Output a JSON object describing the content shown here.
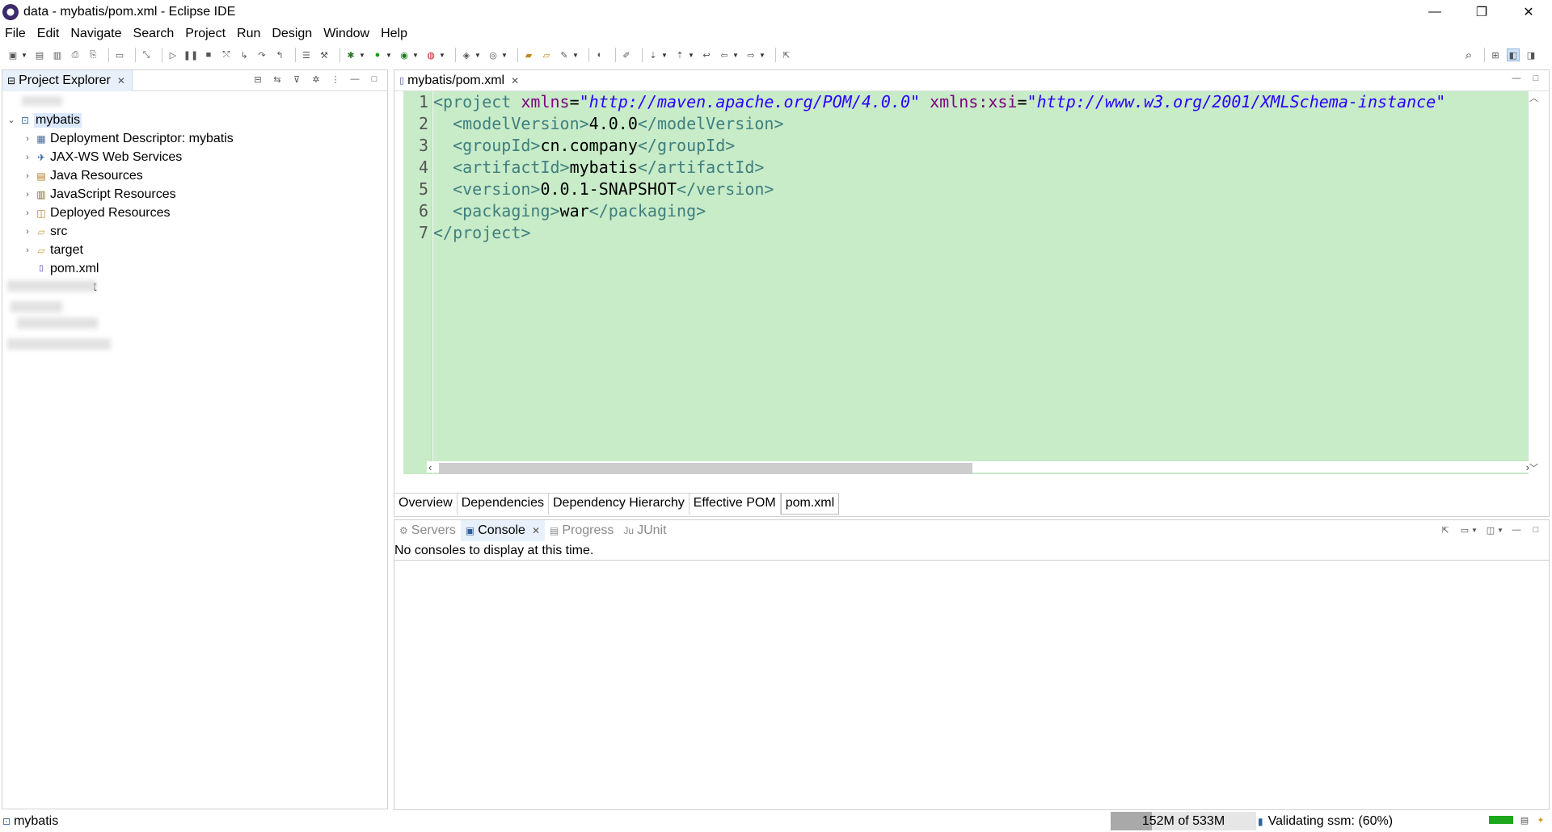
{
  "window": {
    "title": "data - mybatis/pom.xml - Eclipse IDE",
    "controls": {
      "minimize": "—",
      "restore": "❐",
      "close": "✕"
    }
  },
  "menu": [
    "File",
    "Edit",
    "Navigate",
    "Search",
    "Project",
    "Run",
    "Design",
    "Window",
    "Help"
  ],
  "project_explorer": {
    "tab_label": "Project Explorer",
    "tree": [
      {
        "label": "mybatis",
        "icon": "web-project-icon",
        "expanded": true,
        "selected": true
      },
      {
        "label": "Deployment Descriptor: mybatis",
        "icon": "deployment-descriptor-icon"
      },
      {
        "label": "JAX-WS Web Services",
        "icon": "web-services-icon"
      },
      {
        "label": "Java Resources",
        "icon": "java-resources-icon"
      },
      {
        "label": "JavaScript Resources",
        "icon": "javascript-resources-icon"
      },
      {
        "label": "Deployed Resources",
        "icon": "deployed-resources-icon"
      },
      {
        "label": "src",
        "icon": "folder-icon"
      },
      {
        "label": "target",
        "icon": "folder-icon"
      },
      {
        "label": "pom.xml",
        "icon": "xml-file-icon"
      }
    ],
    "partial_label": "t"
  },
  "editor": {
    "tab_label": "mybatis/pom.xml",
    "line_numbers": [
      "1",
      "2",
      "3",
      "4",
      "5",
      "6",
      "7"
    ],
    "lines": [
      {
        "indent": "",
        "open": "<project",
        "attrs": [
          {
            "name": " xmlns",
            "value": "\"http://maven.apache.org/POM/4.0.0\""
          },
          {
            "name": " xmlns:xsi",
            "value": "\"http://www.w3.org/2001/XMLSchema-instance\""
          }
        ]
      },
      {
        "indent": "  ",
        "open": "<modelVersion>",
        "text": "4.0.0",
        "close": "</modelVersion>"
      },
      {
        "indent": "  ",
        "open": "<groupId>",
        "text": "cn.company",
        "close": "</groupId>"
      },
      {
        "indent": "  ",
        "open": "<artifactId>",
        "text": "mybatis",
        "close": "</artifactId>"
      },
      {
        "indent": "  ",
        "open": "<version>",
        "text": "0.0.1-SNAPSHOT",
        "close": "</version>"
      },
      {
        "indent": "  ",
        "open": "<packaging>",
        "text": "war",
        "close": "</packaging>"
      },
      {
        "indent": "",
        "close": "</project>"
      }
    ],
    "bottom_tabs": [
      "Overview",
      "Dependencies",
      "Dependency Hierarchy",
      "Effective POM",
      "pom.xml"
    ],
    "active_bottom_tab": "pom.xml"
  },
  "console_view": {
    "tabs": [
      {
        "label": "Servers",
        "icon": "servers-icon"
      },
      {
        "label": "Console",
        "icon": "console-icon",
        "active": true
      },
      {
        "label": "Progress",
        "icon": "progress-icon"
      },
      {
        "label": "JUnit",
        "icon": "junit-icon"
      }
    ],
    "message": "No consoles to display at this time."
  },
  "statusbar": {
    "selected_item": "mybatis",
    "heap_label": "152M of 533M",
    "heap_used_fraction": 0.285,
    "status_text": "Validating ssm: (60%)"
  },
  "colors": {
    "editor_background": "#c8ebc8",
    "xml_tag": "#3f7f7f",
    "xml_attribute": "#7f007f",
    "xml_string": "#2a00ff",
    "selection": "#d9e8fb"
  }
}
